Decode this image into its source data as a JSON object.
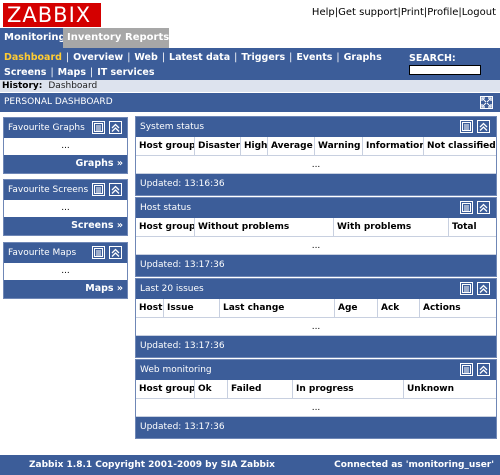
{
  "logo": "ZABBIX",
  "toplinks": [
    "Help",
    "Get support",
    "Print",
    "Profile",
    "Logout"
  ],
  "main_menu": [
    "Monitoring",
    "Inventory",
    "Reports"
  ],
  "sub_menu_row1": [
    "Dashboard",
    "Overview",
    "Web",
    "Latest data",
    "Triggers",
    "Events",
    "Graphs"
  ],
  "sub_menu_row2": [
    "Screens",
    "Maps",
    "IT services"
  ],
  "search_label": "SEARCH:",
  "search_value": "",
  "history": {
    "label": "History:",
    "value": "Dashboard"
  },
  "dashboard_title": "PERSONAL DASHBOARD",
  "favourites": [
    {
      "title": "Favourite Graphs",
      "body": "...",
      "link": "Graphs »"
    },
    {
      "title": "Favourite Screens",
      "body": "...",
      "link": "Screens »"
    },
    {
      "title": "Favourite Maps",
      "body": "...",
      "link": "Maps »"
    }
  ],
  "system_status": {
    "title": "System status",
    "columns": [
      "Host group",
      "Disaster",
      "High",
      "Average",
      "Warning",
      "Information",
      "Not classified"
    ],
    "body": "...",
    "updated": "Updated: 13:16:36"
  },
  "host_status": {
    "title": "Host status",
    "columns": [
      "Host group",
      "Without problems",
      "With problems",
      "Total"
    ],
    "body": "...",
    "updated": "Updated: 13:17:36"
  },
  "last_issues": {
    "title": "Last 20 issues",
    "columns": [
      "Host",
      "Issue",
      "Last change",
      "Age",
      "Ack",
      "Actions"
    ],
    "body": "...",
    "updated": "Updated: 13:17:36"
  },
  "web_monitoring": {
    "title": "Web monitoring",
    "columns": [
      "Host group",
      "Ok",
      "Failed",
      "In progress",
      "Unknown"
    ],
    "body": "...",
    "updated": "Updated: 13:17:36"
  },
  "footer": {
    "left": "Zabbix 1.8.1 Copyright 2001-2009 by SIA Zabbix",
    "right": "Connected as 'monitoring_user'"
  },
  "icons": {
    "menu": "list-icon",
    "collapse": "double-chevron-up-icon",
    "fullscreen": "fullscreen-icon"
  },
  "colors": {
    "header_blue": "#3c5d99",
    "logo_red": "#d40000",
    "active_submenu": "#ffcc33",
    "inactive_tab": "#a7a7a7"
  }
}
